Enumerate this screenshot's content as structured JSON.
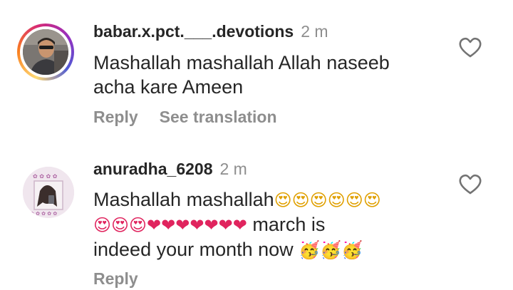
{
  "comments": [
    {
      "username": "babar.x.pct.___.devotions",
      "time": "2 m",
      "text_line1": "Mashallah mashallah Allah naseeb",
      "text_line2": "acha kare Ameen",
      "reply_label": "Reply",
      "translate_label": "See translation",
      "avatar_colors": {
        "ring": "gradient",
        "bg": "#6d6a66",
        "skin": "#c9956f"
      }
    },
    {
      "username": "anuradha_6208",
      "time": "2 m",
      "text_line1": "Mashallah mashallah",
      "line1_emojis": "😍😍😍😍😍😍",
      "line2_emojis": "😍😍😍❤❤❤❤❤❤❤",
      "line2_text": " march is",
      "line3_text": "indeed your month now ",
      "line3_emojis": "🥳🥳🥳",
      "reply_label": "Reply",
      "avatar_colors": {
        "bg": "#efe4ec",
        "accent": "#b06aa6"
      }
    }
  ],
  "colors": {
    "primary_text": "#262626",
    "secondary_text": "#8e8e8e",
    "heart_outline": "#737373",
    "love_red": "#e0245e"
  },
  "icons": {
    "like": "heart-outline-icon"
  }
}
